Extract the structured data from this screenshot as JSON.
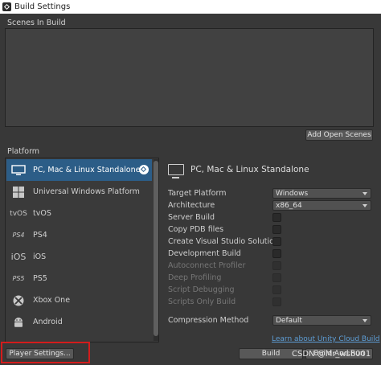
{
  "window": {
    "title": "Build Settings",
    "icon": "unity-icon"
  },
  "scenes": {
    "label": "Scenes In Build",
    "add_button": "Add Open Scenes"
  },
  "platform": {
    "label": "Platform",
    "items": [
      {
        "label": "PC, Mac & Linux Standalone",
        "icon": "monitor-icon",
        "glyph": "",
        "selected": true,
        "active_badge": "unity-icon"
      },
      {
        "label": "Universal Windows Platform",
        "icon": "windows-icon",
        "glyph": "⊞",
        "selected": false
      },
      {
        "label": "tvOS",
        "icon": "tvos-icon",
        "glyph": "tvOS",
        "selected": false
      },
      {
        "label": "PS4",
        "icon": "ps4-icon",
        "glyph": "PS4",
        "selected": false
      },
      {
        "label": "iOS",
        "icon": "ios-icon",
        "glyph": "iOS",
        "selected": false
      },
      {
        "label": "PS5",
        "icon": "ps5-icon",
        "glyph": "PS5",
        "selected": false
      },
      {
        "label": "Xbox One",
        "icon": "xbox-icon",
        "glyph": "⊗",
        "selected": false
      },
      {
        "label": "Android",
        "icon": "android-icon",
        "glyph": "🤖",
        "selected": false
      }
    ]
  },
  "settings": {
    "header": "PC, Mac & Linux Standalone",
    "target_platform": {
      "label": "Target Platform",
      "value": "Windows"
    },
    "architecture": {
      "label": "Architecture",
      "value": "x86_64"
    },
    "server_build": {
      "label": "Server Build"
    },
    "copy_pdb": {
      "label": "Copy PDB files"
    },
    "create_vs": {
      "label": "Create Visual Studio Solution"
    },
    "dev_build": {
      "label": "Development Build"
    },
    "autoconnect": {
      "label": "Autoconnect Profiler"
    },
    "deep_profiling": {
      "label": "Deep Profiling"
    },
    "script_debugging": {
      "label": "Script Debugging"
    },
    "scripts_only": {
      "label": "Scripts Only Build"
    },
    "compression": {
      "label": "Compression Method",
      "value": "Default"
    },
    "cloud_link": "Learn about Unity Cloud Build"
  },
  "footer": {
    "player_settings": "Player Settings...",
    "build": "Build",
    "build_and_run": "Build And Run"
  },
  "overlay": {
    "watermark": "CSDN @Mr_wsb001",
    "highlight_color": "#d41c1c"
  },
  "colors": {
    "selected_row": "#2c5d87",
    "link": "#5e9ed6"
  }
}
